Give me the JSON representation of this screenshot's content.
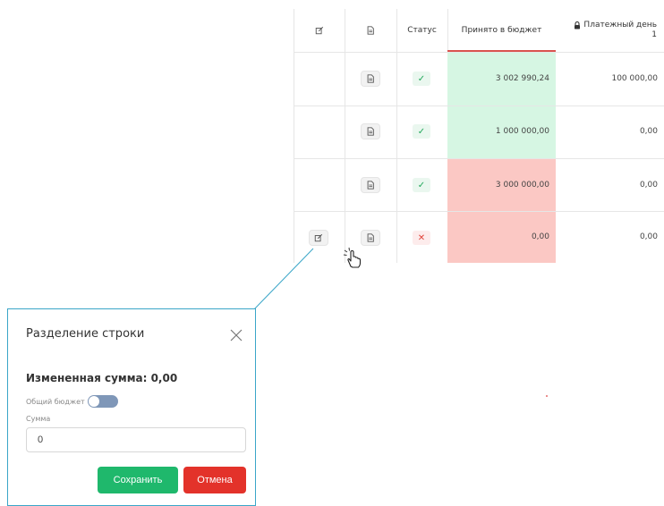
{
  "table": {
    "headers": {
      "status": "Статус",
      "budget": "Принято в бюджет",
      "payday_line1": "Платежный день",
      "payday_line2": "1"
    },
    "rows": [
      {
        "budget": "3 002 990,24",
        "payday": "100 000,00",
        "status": "ok",
        "status_symbol": "✓",
        "budget_color": "#d6f6e3",
        "has_edit": false
      },
      {
        "budget": "1 000 000,00",
        "payday": "0,00",
        "status": "ok",
        "status_symbol": "✓",
        "budget_color": "#d6f6e3",
        "has_edit": false
      },
      {
        "budget": "3 000 000,00",
        "payday": "0,00",
        "status": "ok",
        "status_symbol": "✓",
        "budget_color": "#fbc8c4",
        "has_edit": false
      },
      {
        "budget": "0,00",
        "payday": "0,00",
        "status": "error",
        "status_symbol": "✕",
        "budget_color": "#fbc8c4",
        "has_edit": true
      }
    ]
  },
  "dialog": {
    "title": "Разделение строки",
    "changed_sum": "Измененная сумма: 0,00",
    "toggle_label": "Общий бюджет",
    "toggle_on": false,
    "sum_label": "Сумма",
    "sum_value": "0",
    "save_label": "Сохранить",
    "cancel_label": "Отмена"
  },
  "colors": {
    "accent_green": "#1fb86c",
    "accent_red": "#e3322a",
    "connector": "#3aa6c8"
  },
  "icons": [
    "edit-icon",
    "document-icon",
    "lock-icon",
    "check-icon",
    "cross-icon",
    "close-icon",
    "hand-cursor-icon"
  ]
}
